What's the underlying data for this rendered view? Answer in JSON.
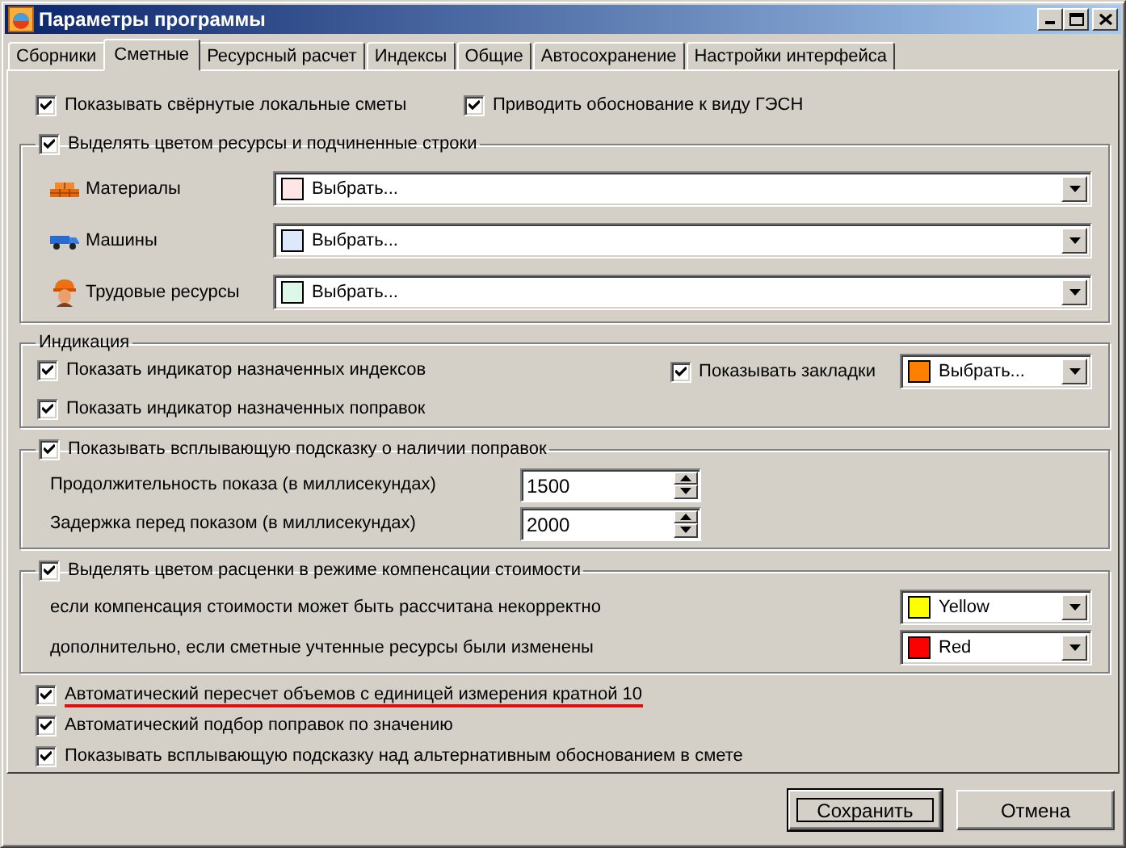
{
  "window": {
    "title": "Параметры программы"
  },
  "tabs": [
    {
      "label": "Сборники",
      "selected": false
    },
    {
      "label": "Сметные",
      "selected": true
    },
    {
      "label": "Ресурсный расчет",
      "selected": false
    },
    {
      "label": "Индексы",
      "selected": false
    },
    {
      "label": "Общие",
      "selected": false
    },
    {
      "label": "Автосохранение",
      "selected": false
    },
    {
      "label": "Настройки интерфейса",
      "selected": false
    }
  ],
  "top_options": [
    {
      "label": "Показывать свёрнутые локальные сметы",
      "checked": true
    },
    {
      "label": "Приводить обоснование к виду ГЭСН",
      "checked": true
    }
  ],
  "resource_colors": {
    "label": "Выделять цветом ресурсы и подчиненные строки",
    "checked": true,
    "rows": [
      {
        "kind": "materials",
        "label": "Материалы",
        "color": "#fde6e6",
        "value": "Выбрать..."
      },
      {
        "kind": "machines",
        "label": "Машины",
        "color": "#dde9fa",
        "value": "Выбрать..."
      },
      {
        "kind": "labor",
        "label": "Трудовые ресурсы",
        "color": "#ddf8e8",
        "value": "Выбрать..."
      }
    ]
  },
  "indication": {
    "title": "Индикация",
    "options": [
      {
        "label": "Показать индикатор назначенных индексов",
        "checked": true
      },
      {
        "label": "Показать индикатор назначенных поправок",
        "checked": true
      }
    ],
    "bookmarks": {
      "label": "Показывать закладки",
      "checked": true,
      "color": "#ff8000",
      "value": "Выбрать..."
    }
  },
  "tooltip": {
    "label": "Показывать всплывающую подсказку о наличии поправок",
    "checked": true,
    "fields": [
      {
        "label": "Продолжительность показа (в миллисекундах)",
        "value": "1500"
      },
      {
        "label": "Задержка перед показом (в миллисекундах)",
        "value": "2000"
      }
    ]
  },
  "compensation": {
    "label": "Выделять цветом расценки в режиме компенсации стоимости",
    "checked": true,
    "rows": [
      {
        "label": "если компенсация стоимости может быть рассчитана некорректно",
        "color": "#ffff00",
        "value": "Yellow"
      },
      {
        "label": "дополнительно, если сметные учтенные ресурсы были изменены",
        "color": "#ff0000",
        "value": "Red"
      }
    ]
  },
  "bottom_options": [
    {
      "label": "Автоматический пересчет объемов с единицей измерения кратной 10",
      "checked": true,
      "underlined": true
    },
    {
      "label": "Автоматический подбор поправок по значению",
      "checked": true,
      "underlined": false
    },
    {
      "label": "Показывать всплывающую подсказку над альтернативным обоснованием в смете",
      "checked": true,
      "underlined": false
    }
  ],
  "buttons": [
    {
      "label": "Сохранить",
      "default": true
    },
    {
      "label": "Отмена",
      "default": false
    }
  ]
}
